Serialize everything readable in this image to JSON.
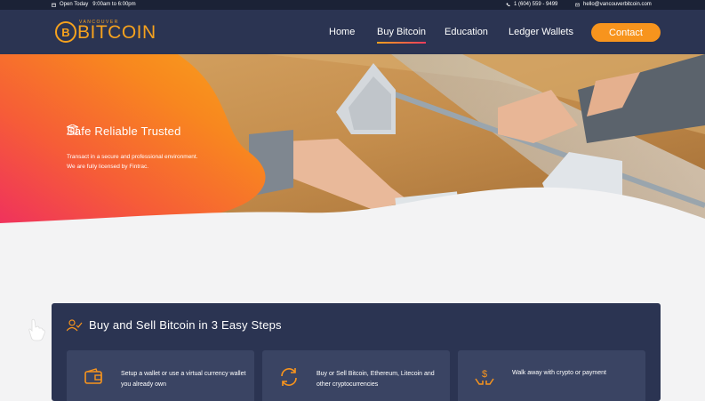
{
  "topbar": {
    "hours": "Open Today   9:00am to 6:00pm",
    "phone": "1 (604) 559 - 9499",
    "email": "hello@vancouverbitcoin.com"
  },
  "brand": {
    "coin_symbol": "B",
    "small": "VANCOUVER",
    "word": "BITCOIN"
  },
  "nav": {
    "items": [
      "Home",
      "Buy Bitcoin",
      "Education",
      "Ledger Wallets"
    ],
    "contact": "Contact"
  },
  "hero": {
    "title": "Safe Reliable Trusted",
    "line1": "Transact in a secure and professional environment.",
    "line2": "We are fully licensed by Fintrac."
  },
  "steps_section": {
    "title": "Buy and Sell Bitcoin in 3 Easy Steps",
    "steps": [
      {
        "icon": "wallet-icon",
        "text": "Setup a wallet or use a virtual currency wallet you already own"
      },
      {
        "icon": "exchange-icon",
        "text": "Buy or Sell Bitcoin, Ethereum, Litecoin and other cryptocurrencies"
      },
      {
        "icon": "money-hand-icon",
        "text": "Walk away with crypto or payment"
      }
    ]
  },
  "colors": {
    "nav_bg": "#2b3452",
    "topbar_bg": "#1b2236",
    "accent": "#f7941d",
    "hero_gradient_start": "#ef3b5d"
  }
}
